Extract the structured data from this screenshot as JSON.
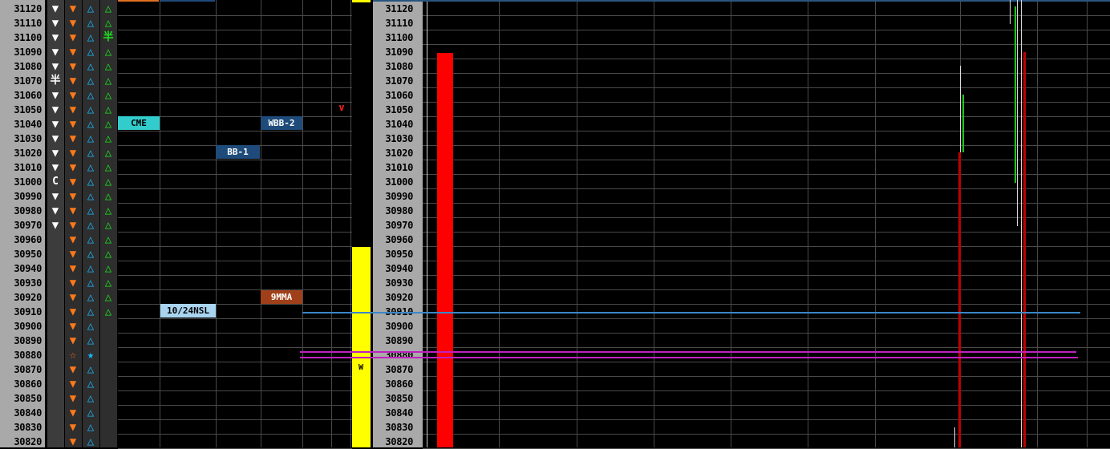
{
  "prices": [
    "31120",
    "31110",
    "31100",
    "31090",
    "31080",
    "31070",
    "31060",
    "31050",
    "31040",
    "31030",
    "31020",
    "31010",
    "31000",
    "30990",
    "30980",
    "30970",
    "30960",
    "30950",
    "30940",
    "30930",
    "30920",
    "30910",
    "30900",
    "30890",
    "30880",
    "30870",
    "30860",
    "30850",
    "30840",
    "30830",
    "30820"
  ],
  "signals": {
    "col1": [
      "▼",
      "▼",
      "▼",
      "▼",
      "▼",
      "半",
      "▼",
      "▼",
      "▼",
      "▼",
      "▼",
      "▼",
      "C",
      "▼",
      "▼",
      "▼",
      "",
      "",
      "",
      "",
      "",
      "",
      "",
      "",
      "",
      "",
      "",
      "",
      "",
      "",
      ""
    ],
    "col2": [
      "▼",
      "▼",
      "▼",
      "▼",
      "▼",
      "▼",
      "▼",
      "▼",
      "▼",
      "▼",
      "▼",
      "▼",
      "▼",
      "▼",
      "▼",
      "▼",
      "▼",
      "▼",
      "▼",
      "▼",
      "▼",
      "▼",
      "▼",
      "▼",
      "☆",
      "▼",
      "▼",
      "▼",
      "▼",
      "▼",
      "▼"
    ],
    "col3": [
      "△",
      "△",
      "△",
      "△",
      "△",
      "△",
      "△",
      "△",
      "△",
      "△",
      "△",
      "△",
      "△",
      "△",
      "△",
      "△",
      "△",
      "△",
      "△",
      "△",
      "△",
      "△",
      "△",
      "△",
      "★",
      "△",
      "△",
      "△",
      "△",
      "△",
      "△"
    ],
    "col4": [
      "△",
      "△",
      "半",
      "△",
      "△",
      "△",
      "△",
      "△",
      "△",
      "△",
      "△",
      "△",
      "△",
      "△",
      "△",
      "△",
      "△",
      "△",
      "△",
      "△",
      "△",
      "△",
      "",
      "",
      "",
      "",
      "",
      "",
      "",
      "",
      ""
    ]
  },
  "labels": {
    "cme": "CME",
    "wbb2": "WBB-2",
    "bb1": "BB-1",
    "nma": "9MMA",
    "nsl": "10/24NSL",
    "arrow": "v",
    "w_marker": "W"
  },
  "colors": {
    "price_bg": "#a9a9a9",
    "grid": "#4a4a4a",
    "red_bar": "#ff0000",
    "yellow_bar": "#ffff00",
    "cyan_label": "#33cccc",
    "navy_label": "#1e4b7a",
    "brown_label": "#a0401a",
    "light_label": "#a8d4f0",
    "blue_line": "#3a86c8",
    "magenta_line": "#c020c0"
  }
}
